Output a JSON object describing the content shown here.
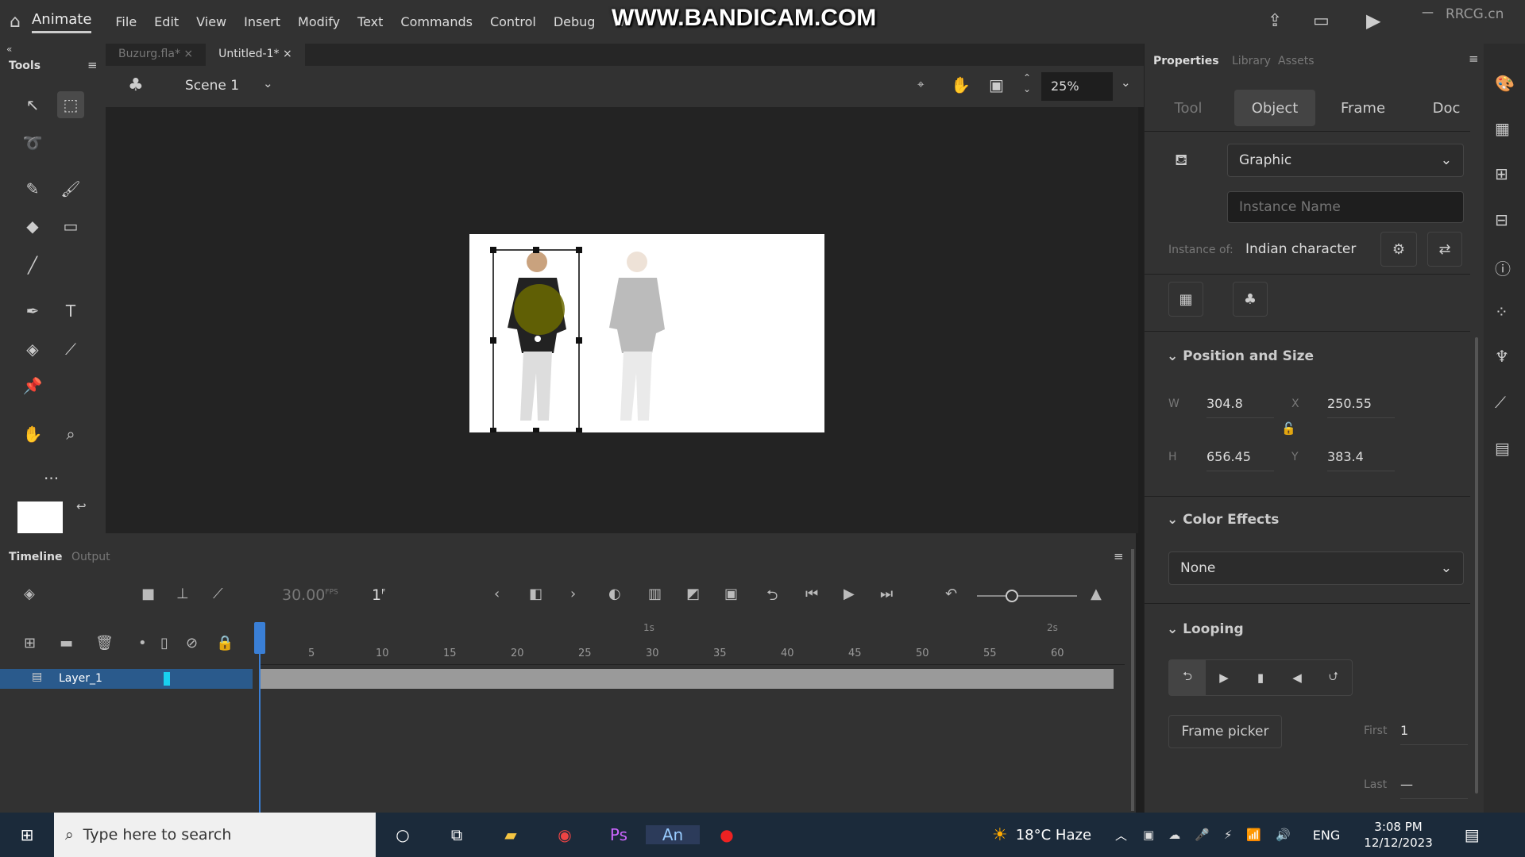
{
  "app": {
    "name": "Animate",
    "menu": [
      "File",
      "Edit",
      "View",
      "Insert",
      "Modify",
      "Text",
      "Commands",
      "Control",
      "Debug",
      "W"
    ],
    "watermark": "WWW.BANDICAM.COM",
    "corner_watermark": "RRCG.cn"
  },
  "doc_tabs": [
    {
      "label": "Buzurg.fla*",
      "active": false
    },
    {
      "label": "Untitled-1*",
      "active": true
    }
  ],
  "tools_panel": {
    "title": "Tools",
    "more": "..."
  },
  "scene": {
    "name": "Scene 1",
    "zoom": "25%"
  },
  "properties": {
    "tabs": [
      "Properties",
      "Library",
      "Assets"
    ],
    "segments": [
      "Tool",
      "Object",
      "Frame",
      "Doc"
    ],
    "active_segment": "Object",
    "symbol_type": "Graphic",
    "instance_name_placeholder": "Instance Name",
    "instance_of_label": "Instance of:",
    "instance_of": "Indian character",
    "position_size": {
      "title": "Position and Size",
      "w_label": "W",
      "w": "304.8",
      "h_label": "H",
      "h": "656.45",
      "x_label": "X",
      "x": "250.55",
      "y_label": "Y",
      "y": "383.4"
    },
    "color_effects": {
      "title": "Color Effects",
      "value": "None"
    },
    "looping": {
      "title": "Looping",
      "frame_picker": "Frame picker",
      "first_label": "First",
      "first": "1",
      "last_label": "Last",
      "last": "—"
    }
  },
  "timeline": {
    "tabs": [
      "Timeline",
      "Output"
    ],
    "fps": "30.00",
    "fps_unit": "FPS",
    "frame": "1",
    "frame_unit": "F",
    "ruler": [
      "5",
      "10",
      "15",
      "20",
      "25",
      "30",
      "35",
      "40",
      "45",
      "50",
      "55",
      "60"
    ],
    "seconds": [
      "1s",
      "2s"
    ],
    "layers": [
      {
        "name": "Layer_1",
        "color": "#19d0f0"
      }
    ]
  },
  "taskbar": {
    "search_placeholder": "Type here to search",
    "weather": "18°C  Haze",
    "lang": "ENG",
    "time": "3:08 PM",
    "date": "12/12/2023"
  }
}
